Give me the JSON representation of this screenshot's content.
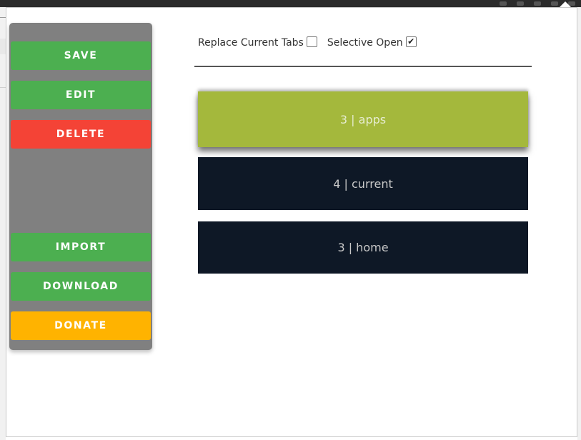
{
  "sidebar": {
    "save_label": "SAVE",
    "edit_label": "EDIT",
    "delete_label": "DELETE",
    "import_label": "IMPORT",
    "download_label": "DOWNLOAD",
    "donate_label": "DONATE"
  },
  "options": {
    "replace_current_tabs": {
      "label": "Replace Current Tabs",
      "checked": false
    },
    "selective_open": {
      "label": "Selective Open",
      "checked": true
    }
  },
  "sessions": [
    {
      "label": "3 | apps",
      "selected": true
    },
    {
      "label": "4 | current",
      "selected": false
    },
    {
      "label": "3 | home",
      "selected": false
    }
  ],
  "colors": {
    "green": "#4caf50",
    "red": "#f44336",
    "amber": "#ffb300",
    "sidebar_bg": "#808080",
    "selected_session": "#a4b83c",
    "session_bg": "#0e1826"
  }
}
